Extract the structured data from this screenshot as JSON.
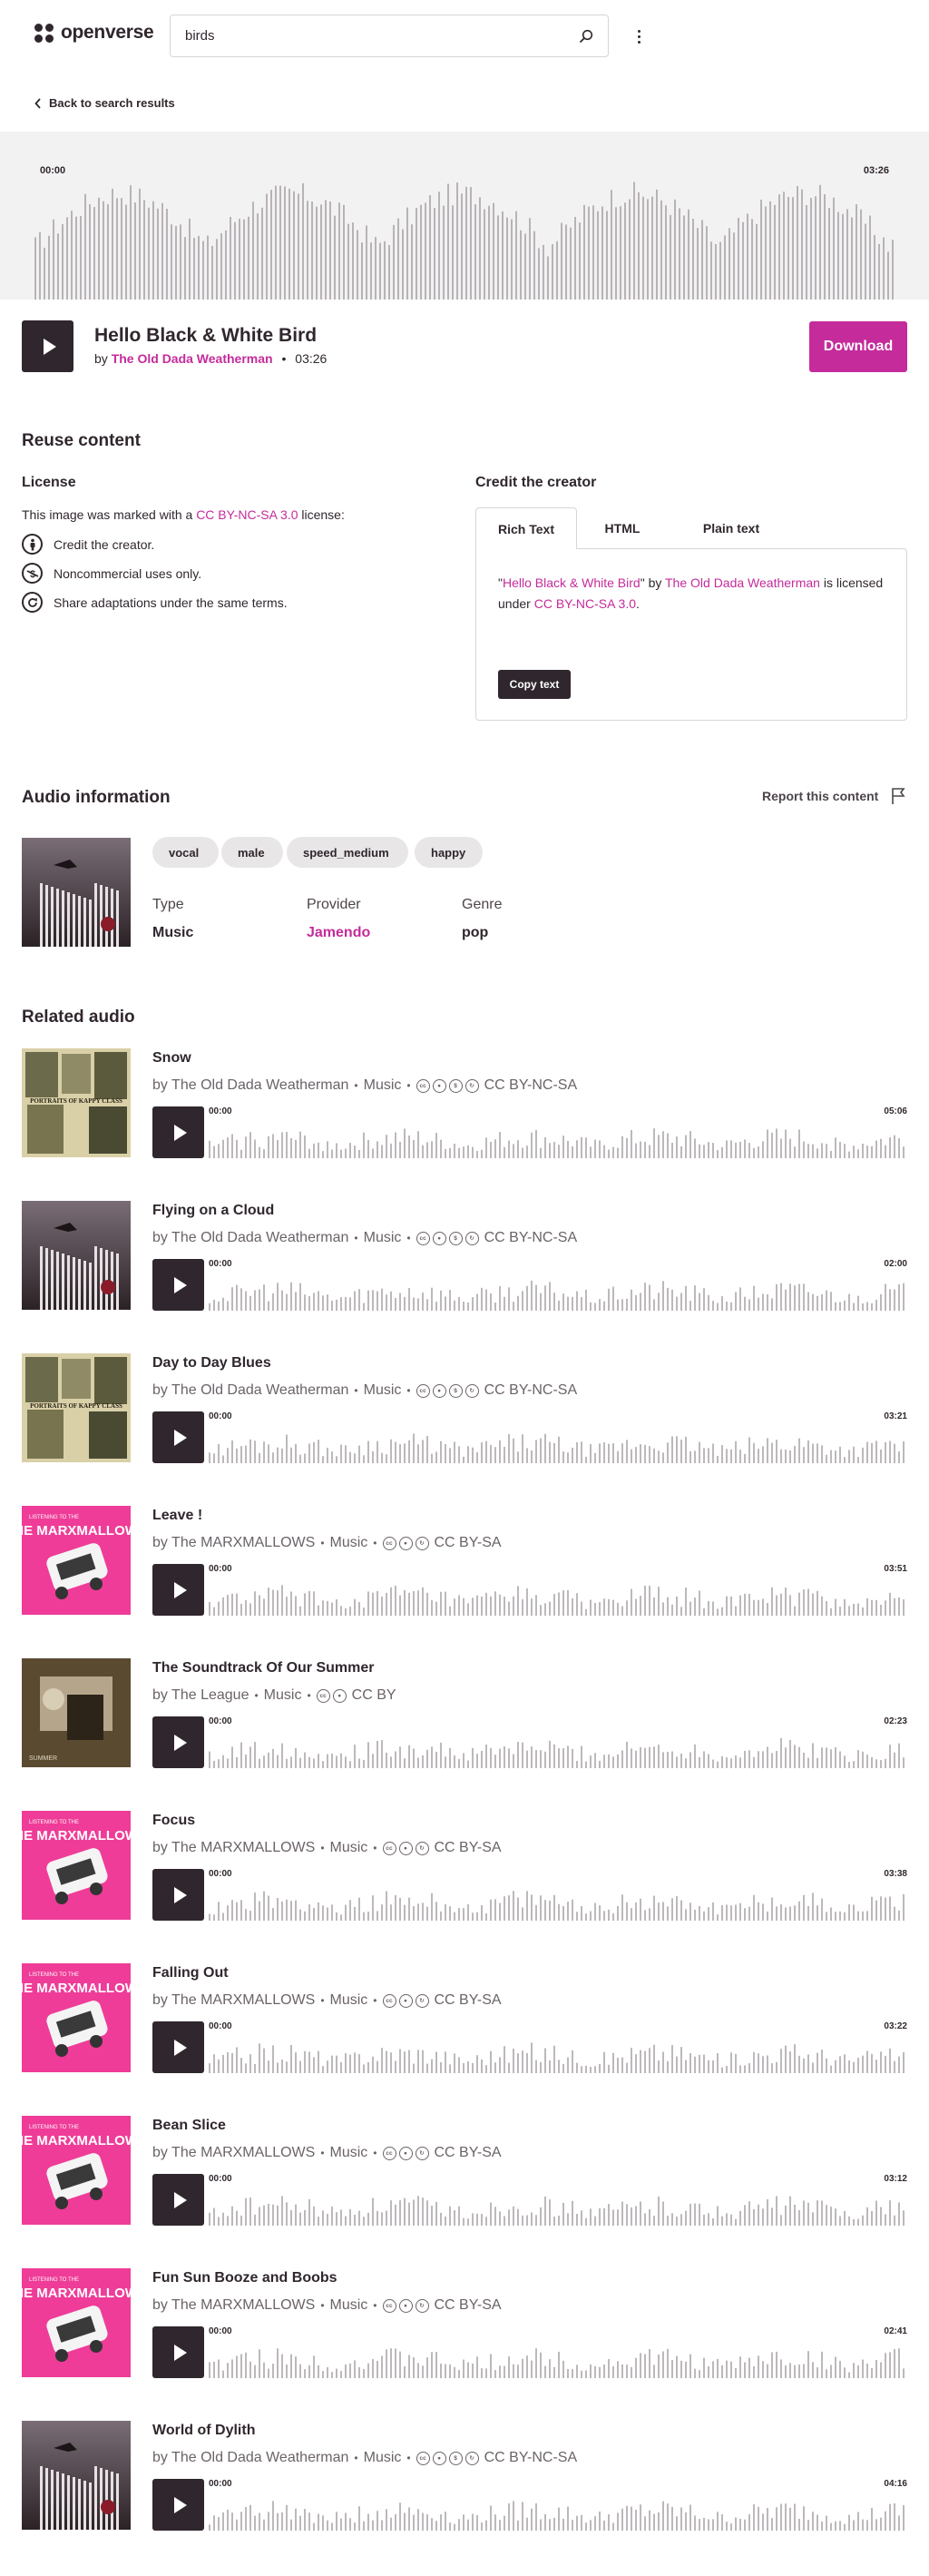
{
  "header": {
    "brand": "openverse",
    "search_value": "birds"
  },
  "back_link": "Back to search results",
  "player": {
    "time_start": "00:00",
    "time_end": "03:26"
  },
  "track": {
    "title": "Hello Black & White Bird",
    "by": "by",
    "artist": "The Old Dada Weatherman",
    "sep": "•",
    "duration": "03:26",
    "download_label": "Download"
  },
  "reuse": {
    "heading": "Reuse content",
    "license_heading": "License",
    "license_pre": "This image was marked with a ",
    "license_link": "CC BY-NC-SA 3.0",
    "license_post": " license:",
    "terms": [
      "Credit the creator.",
      "Noncommercial uses only.",
      "Share adaptations under the same terms."
    ],
    "credit_heading": "Credit the creator",
    "tabs": [
      "Rich Text",
      "HTML",
      "Plain text"
    ],
    "credit": {
      "q1": "\"",
      "title": "Hello Black & White Bird",
      "q2": "\" by ",
      "artist": "The Old Dada Weatherman",
      "mid": " is licensed under ",
      "license": "CC BY-NC-SA 3.0",
      "end": "."
    },
    "copy_label": "Copy text"
  },
  "audio_info": {
    "heading": "Audio information",
    "report_label": "Report this content",
    "tags": [
      "vocal",
      "male",
      "speed_medium",
      "happy"
    ],
    "type_label": "Type",
    "type_value": "Music",
    "provider_label": "Provider",
    "provider_value": "Jamendo",
    "genre_label": "Genre",
    "genre_value": "pop"
  },
  "related": {
    "heading": "Related audio",
    "items": [
      {
        "title": "Snow",
        "artist": "by The Old Dada Weatherman",
        "category": "Music",
        "license": "CC BY-NC-SA",
        "icons": [
          "cc",
          "by",
          "nc",
          "sa"
        ],
        "start": "00:00",
        "duration": "05:06",
        "cover": "collage"
      },
      {
        "title": "Flying on a Cloud",
        "artist": "by The Old Dada Weatherman",
        "category": "Music",
        "license": "CC BY-NC-SA",
        "icons": [
          "cc",
          "by",
          "nc",
          "sa"
        ],
        "start": "00:00",
        "duration": "02:00",
        "cover": "bird"
      },
      {
        "title": "Day to Day Blues",
        "artist": "by The Old Dada Weatherman",
        "category": "Music",
        "license": "CC BY-NC-SA",
        "icons": [
          "cc",
          "by",
          "nc",
          "sa"
        ],
        "start": "00:00",
        "duration": "03:21",
        "cover": "collage"
      },
      {
        "title": "Leave !",
        "artist": "by The MARXMALLOWS",
        "category": "Music",
        "license": "CC BY-SA",
        "icons": [
          "cc",
          "by",
          "sa"
        ],
        "start": "00:00",
        "duration": "03:51",
        "cover": "marx"
      },
      {
        "title": "The Soundtrack Of Our Summer",
        "artist": "by The League",
        "category": "Music",
        "license": "CC BY",
        "icons": [
          "cc",
          "by"
        ],
        "start": "00:00",
        "duration": "02:23",
        "cover": "league"
      },
      {
        "title": "Focus",
        "artist": "by The MARXMALLOWS",
        "category": "Music",
        "license": "CC BY-SA",
        "icons": [
          "cc",
          "by",
          "sa"
        ],
        "start": "00:00",
        "duration": "03:38",
        "cover": "marx"
      },
      {
        "title": "Falling Out",
        "artist": "by The MARXMALLOWS",
        "category": "Music",
        "license": "CC BY-SA",
        "icons": [
          "cc",
          "by",
          "sa"
        ],
        "start": "00:00",
        "duration": "03:22",
        "cover": "marx"
      },
      {
        "title": "Bean Slice",
        "artist": "by The MARXMALLOWS",
        "category": "Music",
        "license": "CC BY-SA",
        "icons": [
          "cc",
          "by",
          "sa"
        ],
        "start": "00:00",
        "duration": "03:12",
        "cover": "marx"
      },
      {
        "title": "Fun Sun Booze and Boobs",
        "artist": "by The MARXMALLOWS",
        "category": "Music",
        "license": "CC BY-SA",
        "icons": [
          "cc",
          "by",
          "sa"
        ],
        "start": "00:00",
        "duration": "02:41",
        "cover": "marx"
      },
      {
        "title": "World of Dylith",
        "artist": "by The Old Dada Weatherman",
        "category": "Music",
        "license": "CC BY-NC-SA",
        "icons": [
          "cc",
          "by",
          "nc",
          "sa"
        ],
        "start": "00:00",
        "duration": "04:16",
        "cover": "bird"
      }
    ]
  },
  "covers": {
    "collage_text": "PORTRAITS OF KAPPY CLASS",
    "marx_small": "LISTENING TO THE",
    "marx_big": "THE MARXMALLOWS",
    "league_text": "SUMMER"
  },
  "colors": {
    "accent": "#c52b9b",
    "dark": "#30272e",
    "wave_bg": "#f3f2f3",
    "marx_pink": "#ef3c98"
  }
}
